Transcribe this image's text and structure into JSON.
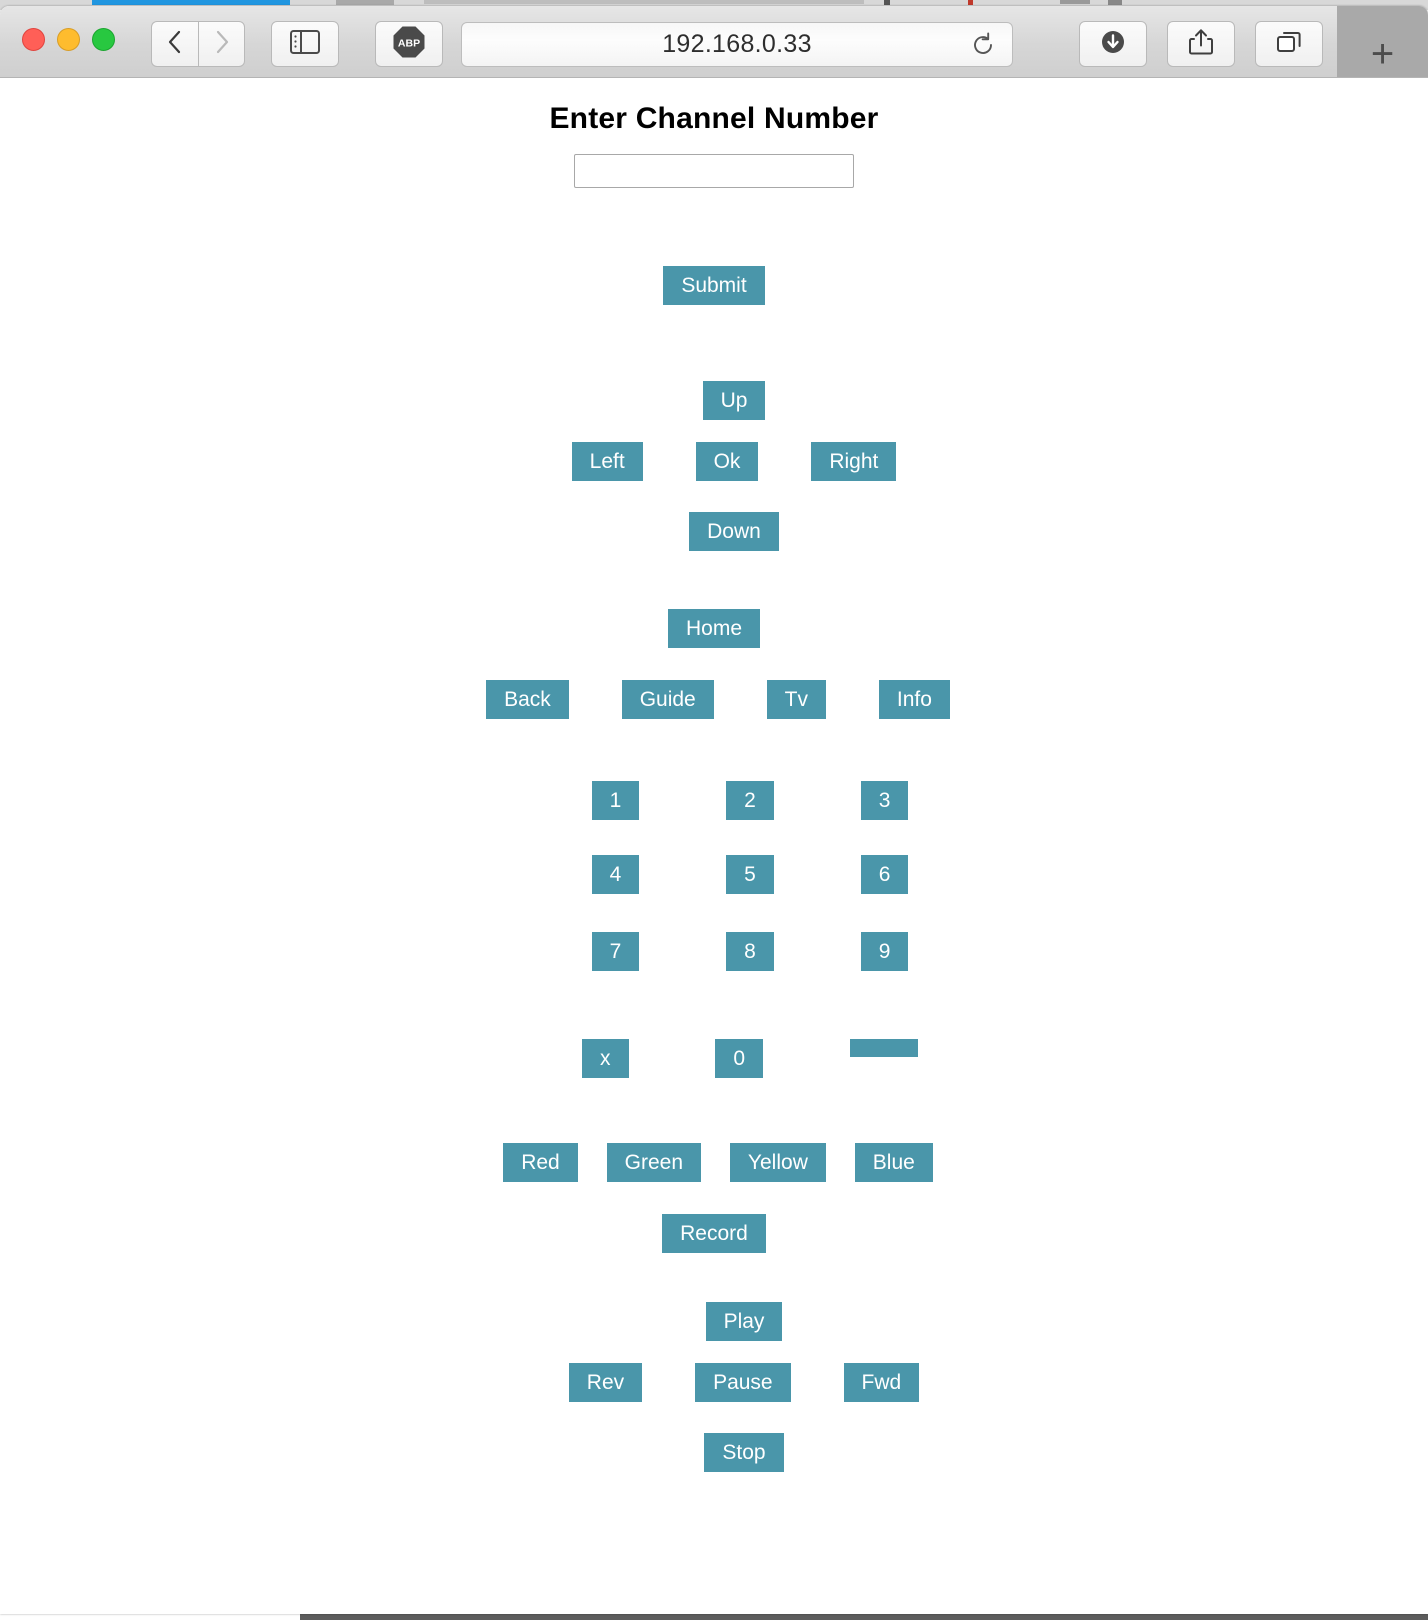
{
  "browser": {
    "url": "192.168.0.33",
    "traffic_lights": [
      "close",
      "minimize",
      "zoom"
    ],
    "back_label": "back-arrow-icon",
    "forward_label": "forward-arrow-icon",
    "sidebar_label": "sidebar-icon",
    "adblock_label": "ABP",
    "reload_label": "reload-icon",
    "downloads_label": "downloads-icon",
    "share_label": "share-icon",
    "tabs_label": "tab-overview-icon",
    "new_tab_label": "+"
  },
  "page": {
    "heading": "Enter Channel Number",
    "input_value": "",
    "input_placeholder": "",
    "accent_color": "#4a96aa",
    "text_color": "#ffffff",
    "submit": "Submit",
    "dpad": {
      "up": "Up",
      "left": "Left",
      "ok": "Ok",
      "right": "Right",
      "down": "Down"
    },
    "nav": {
      "home": "Home",
      "back": "Back",
      "guide": "Guide",
      "tv": "Tv",
      "info": "Info"
    },
    "keypad": {
      "row1": [
        "1",
        "2",
        "3"
      ],
      "row2": [
        "4",
        "5",
        "6"
      ],
      "row3": [
        "7",
        "8",
        "9"
      ],
      "row4": [
        "x",
        "0",
        ""
      ]
    },
    "colors": {
      "red": "Red",
      "green": "Green",
      "yellow": "Yellow",
      "blue": "Blue"
    },
    "record": "Record",
    "transport": {
      "play": "Play",
      "rev": "Rev",
      "pause": "Pause",
      "fwd": "Fwd",
      "stop": "Stop"
    }
  }
}
